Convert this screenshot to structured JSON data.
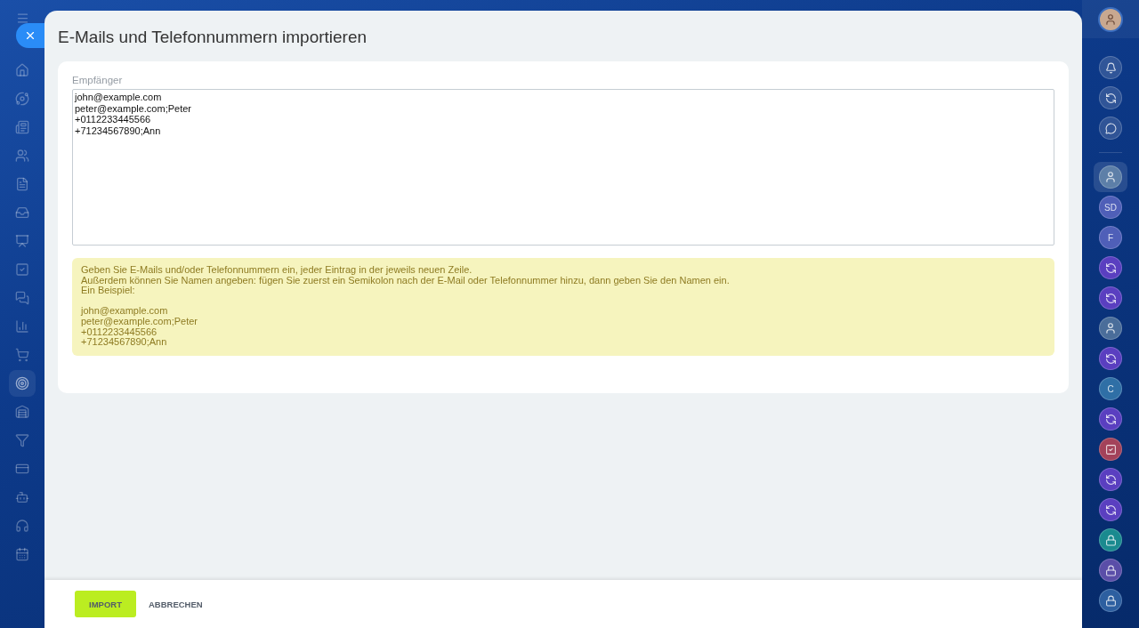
{
  "left_nav": [
    {
      "selected": false
    },
    {
      "selected": false
    },
    {
      "selected": false
    },
    {
      "selected": false
    },
    {
      "selected": false
    },
    {
      "selected": false
    },
    {
      "selected": false
    },
    {
      "selected": false
    },
    {
      "selected": false
    },
    {
      "selected": false
    },
    {
      "selected": false
    },
    {
      "selected": true
    },
    {
      "selected": false
    },
    {
      "selected": false
    },
    {
      "selected": false
    },
    {
      "selected": false
    },
    {
      "selected": false
    },
    {
      "selected": false
    }
  ],
  "dialog": {
    "title": "E-Mails und Telefonnummern importieren",
    "recipients": {
      "label": "Empfänger",
      "value": "john@example.com\npeter@example.com;Peter\n+0112233445566\n+71234567890;Ann"
    },
    "hint": {
      "intro_lines": [
        "Geben Sie E-Mails und/oder Telefonnummern ein, jeder Eintrag in der jeweils neuen Zeile.",
        "Außerdem können Sie Namen angeben: fügen Sie zuerst ein Semikolon nach der E-Mail oder Telefonnummer hinzu, dann geben Sie den Namen ein.",
        "Ein Beispiel:"
      ],
      "example_lines": [
        "john@example.com",
        "peter@example.com;Peter",
        "+0112233445566",
        "+71234567890;Ann"
      ]
    },
    "buttons": [
      {
        "kind": "primary",
        "label": "IMPORT"
      },
      {
        "kind": "link",
        "label": "ABBRECHEN"
      }
    ]
  },
  "right_bar": {
    "top": [
      {
        "kind": "bell"
      },
      {
        "kind": "swirl"
      },
      {
        "kind": "chat"
      }
    ],
    "chats": [
      {
        "kind": "avatar",
        "selected": true,
        "color": "#5d7fa8"
      },
      {
        "kind": "initials",
        "text": "SD",
        "selected": false,
        "color": "#4f5fb8"
      },
      {
        "kind": "initials",
        "text": "F",
        "selected": false,
        "color": "#4f5fb8"
      },
      {
        "kind": "swirl",
        "selected": false,
        "color": "#5a3fc0"
      },
      {
        "kind": "swirl",
        "selected": false,
        "color": "#5a3fc0"
      },
      {
        "kind": "avatar",
        "selected": false,
        "color": "#4a6d9a"
      },
      {
        "kind": "swirl",
        "selected": false,
        "color": "#5a3fc0"
      },
      {
        "kind": "initials",
        "text": "C",
        "selected": false,
        "color": "#2f6fa6"
      },
      {
        "kind": "swirl",
        "selected": false,
        "color": "#5a3fc0"
      },
      {
        "kind": "task",
        "selected": false,
        "color": "#a3425a"
      },
      {
        "kind": "swirl",
        "selected": false,
        "color": "#5a3fc0"
      },
      {
        "kind": "swirl",
        "selected": false,
        "color": "#5a3fc0"
      },
      {
        "kind": "lock",
        "selected": false,
        "color": "#1a8a8f"
      },
      {
        "kind": "lock",
        "selected": false,
        "color": "#5a4ea8"
      },
      {
        "kind": "lock",
        "selected": false,
        "color": "#2d5fa0"
      }
    ]
  }
}
